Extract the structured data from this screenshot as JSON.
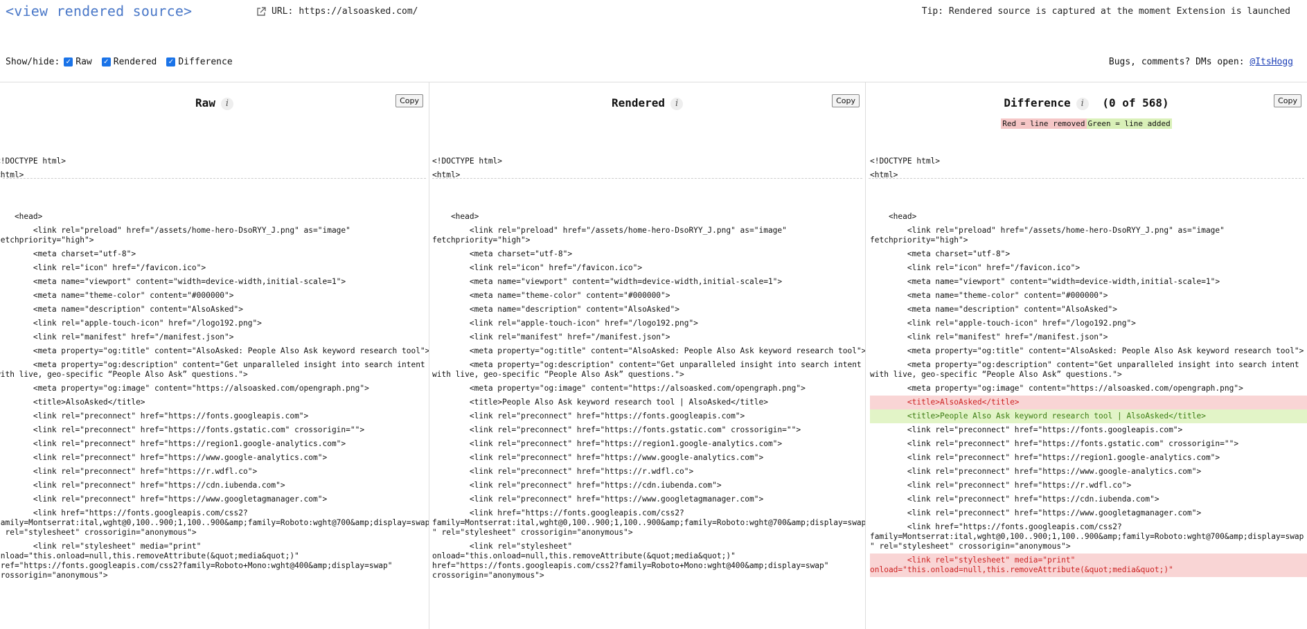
{
  "header": {
    "logo": "<view rendered source>",
    "url_label": "URL:",
    "url": "https://alsoasked.com/",
    "tip": "Tip: Rendered source is captured at the moment Extension is launched"
  },
  "controls": {
    "showhide_label": "Show/hide:",
    "raw_label": "Raw",
    "rendered_label": "Rendered",
    "difference_label": "Difference",
    "bugs_text": "Bugs, comments? DMs open:",
    "bugs_link": "@ItsHogg"
  },
  "panels": {
    "raw": {
      "title": "Raw",
      "copy": "Copy"
    },
    "rendered": {
      "title": "Rendered",
      "copy": "Copy"
    },
    "difference": {
      "title": "Difference",
      "count": "(0 of 568)",
      "copy": "Copy",
      "legend_removed": "Red = line removed",
      "legend_added": "Green = line added"
    }
  },
  "raw_lines": [
    "<!DOCTYPE html>",
    "<html>",
    "",
    "",
    "    <head>",
    "        <link rel=\"preload\" href=\"/assets/home-hero-DsoRYY_J.png\" as=\"image\"\nfetchpriority=\"high\">",
    "        <meta charset=\"utf-8\">",
    "        <link rel=\"icon\" href=\"/favicon.ico\">",
    "        <meta name=\"viewport\" content=\"width=device-width,initial-scale=1\">",
    "        <meta name=\"theme-color\" content=\"#000000\">",
    "        <meta name=\"description\" content=\"AlsoAsked\">",
    "        <link rel=\"apple-touch-icon\" href=\"/logo192.png\">",
    "        <link rel=\"manifest\" href=\"/manifest.json\">",
    "        <meta property=\"og:title\" content=\"AlsoAsked: People Also Ask keyword research tool\">",
    "        <meta property=\"og:description\" content=\"Get unparalleled insight into search intent\nwith live, geo-specific “People Also Ask” questions.\">",
    "        <meta property=\"og:image\" content=\"https://alsoasked.com/opengraph.png\">",
    "        <title>AlsoAsked</title>",
    "        <link rel=\"preconnect\" href=\"https://fonts.googleapis.com\">",
    "        <link rel=\"preconnect\" href=\"https://fonts.gstatic.com\" crossorigin=\"\">",
    "        <link rel=\"preconnect\" href=\"https://region1.google-analytics.com\">",
    "        <link rel=\"preconnect\" href=\"https://www.google-analytics.com\">",
    "        <link rel=\"preconnect\" href=\"https://r.wdfl.co\">",
    "        <link rel=\"preconnect\" href=\"https://cdn.iubenda.com\">",
    "        <link rel=\"preconnect\" href=\"https://www.googletagmanager.com\">",
    "        <link href=\"https://fonts.googleapis.com/css2?\nfamily=Montserrat:ital,wght@0,100..900;1,100..900&amp;family=Roboto:wght@700&amp;display=swap\n\" rel=\"stylesheet\" crossorigin=\"anonymous\">",
    "        <link rel=\"stylesheet\" media=\"print\"\nonload=\"this.onload=null,this.removeAttribute(&quot;media&quot;)\"\nhref=\"https://fonts.googleapis.com/css2?family=Roboto+Mono:wght@400&amp;display=swap\"\ncrossorigin=\"anonymous\">"
  ],
  "rendered_lines": [
    "<!DOCTYPE html>",
    "<html>",
    "",
    "",
    "    <head>",
    "        <link rel=\"preload\" href=\"/assets/home-hero-DsoRYY_J.png\" as=\"image\"\nfetchpriority=\"high\">",
    "        <meta charset=\"utf-8\">",
    "        <link rel=\"icon\" href=\"/favicon.ico\">",
    "        <meta name=\"viewport\" content=\"width=device-width,initial-scale=1\">",
    "        <meta name=\"theme-color\" content=\"#000000\">",
    "        <meta name=\"description\" content=\"AlsoAsked\">",
    "        <link rel=\"apple-touch-icon\" href=\"/logo192.png\">",
    "        <link rel=\"manifest\" href=\"/manifest.json\">",
    "        <meta property=\"og:title\" content=\"AlsoAsked: People Also Ask keyword research tool\">",
    "        <meta property=\"og:description\" content=\"Get unparalleled insight into search intent\nwith live, geo-specific “People Also Ask” questions.\">",
    "        <meta property=\"og:image\" content=\"https://alsoasked.com/opengraph.png\">",
    "        <title>People Also Ask keyword research tool | AlsoAsked</title>",
    "        <link rel=\"preconnect\" href=\"https://fonts.googleapis.com\">",
    "        <link rel=\"preconnect\" href=\"https://fonts.gstatic.com\" crossorigin=\"\">",
    "        <link rel=\"preconnect\" href=\"https://region1.google-analytics.com\">",
    "        <link rel=\"preconnect\" href=\"https://www.google-analytics.com\">",
    "        <link rel=\"preconnect\" href=\"https://r.wdfl.co\">",
    "        <link rel=\"preconnect\" href=\"https://cdn.iubenda.com\">",
    "        <link rel=\"preconnect\" href=\"https://www.googletagmanager.com\">",
    "        <link href=\"https://fonts.googleapis.com/css2?\nfamily=Montserrat:ital,wght@0,100..900;1,100..900&amp;family=Roboto:wght@700&amp;display=swap\n\" rel=\"stylesheet\" crossorigin=\"anonymous\">",
    "        <link rel=\"stylesheet\"\nonload=\"this.onload=null,this.removeAttribute(&quot;media&quot;)\"\nhref=\"https://fonts.googleapis.com/css2?family=Roboto+Mono:wght@400&amp;display=swap\"\ncrossorigin=\"anonymous\">"
  ],
  "diff_lines": [
    {
      "t": "<!DOCTYPE html>",
      "k": ""
    },
    {
      "t": "<html>",
      "k": ""
    },
    {
      "t": "",
      "k": ""
    },
    {
      "t": "",
      "k": ""
    },
    {
      "t": "    <head>",
      "k": ""
    },
    {
      "t": "        <link rel=\"preload\" href=\"/assets/home-hero-DsoRYY_J.png\" as=\"image\"\nfetchpriority=\"high\">",
      "k": ""
    },
    {
      "t": "        <meta charset=\"utf-8\">",
      "k": ""
    },
    {
      "t": "        <link rel=\"icon\" href=\"/favicon.ico\">",
      "k": ""
    },
    {
      "t": "        <meta name=\"viewport\" content=\"width=device-width,initial-scale=1\">",
      "k": ""
    },
    {
      "t": "        <meta name=\"theme-color\" content=\"#000000\">",
      "k": ""
    },
    {
      "t": "        <meta name=\"description\" content=\"AlsoAsked\">",
      "k": ""
    },
    {
      "t": "        <link rel=\"apple-touch-icon\" href=\"/logo192.png\">",
      "k": ""
    },
    {
      "t": "        <link rel=\"manifest\" href=\"/manifest.json\">",
      "k": ""
    },
    {
      "t": "        <meta property=\"og:title\" content=\"AlsoAsked: People Also Ask keyword research tool\">",
      "k": ""
    },
    {
      "t": "        <meta property=\"og:description\" content=\"Get unparalleled insight into search intent\nwith live, geo-specific “People Also Ask” questions.\">",
      "k": ""
    },
    {
      "t": "        <meta property=\"og:image\" content=\"https://alsoasked.com/opengraph.png\">",
      "k": ""
    },
    {
      "t": "        <title>AlsoAsked</title>",
      "k": "removed"
    },
    {
      "t": "        <title>People Also Ask keyword research tool | AlsoAsked</title>",
      "k": "added"
    },
    {
      "t": "        <link rel=\"preconnect\" href=\"https://fonts.googleapis.com\">",
      "k": ""
    },
    {
      "t": "        <link rel=\"preconnect\" href=\"https://fonts.gstatic.com\" crossorigin=\"\">",
      "k": ""
    },
    {
      "t": "        <link rel=\"preconnect\" href=\"https://region1.google-analytics.com\">",
      "k": ""
    },
    {
      "t": "        <link rel=\"preconnect\" href=\"https://www.google-analytics.com\">",
      "k": ""
    },
    {
      "t": "        <link rel=\"preconnect\" href=\"https://r.wdfl.co\">",
      "k": ""
    },
    {
      "t": "        <link rel=\"preconnect\" href=\"https://cdn.iubenda.com\">",
      "k": ""
    },
    {
      "t": "        <link rel=\"preconnect\" href=\"https://www.googletagmanager.com\">",
      "k": ""
    },
    {
      "t": "        <link href=\"https://fonts.googleapis.com/css2?\nfamily=Montserrat:ital,wght@0,100..900;1,100..900&amp;family=Roboto:wght@700&amp;display=swap\n\" rel=\"stylesheet\" crossorigin=\"anonymous\">",
      "k": ""
    },
    {
      "t": "        <link rel=\"stylesheet\" media=\"print\"\nonload=\"this.onload=null,this.removeAttribute(&quot;media&quot;)\"",
      "k": "removed"
    }
  ],
  "colors": {
    "logo": "#4a78c8",
    "checkbox": "#1a73e8",
    "removed_bg": "#f9d5d5",
    "added_bg": "#e2f4c7"
  }
}
